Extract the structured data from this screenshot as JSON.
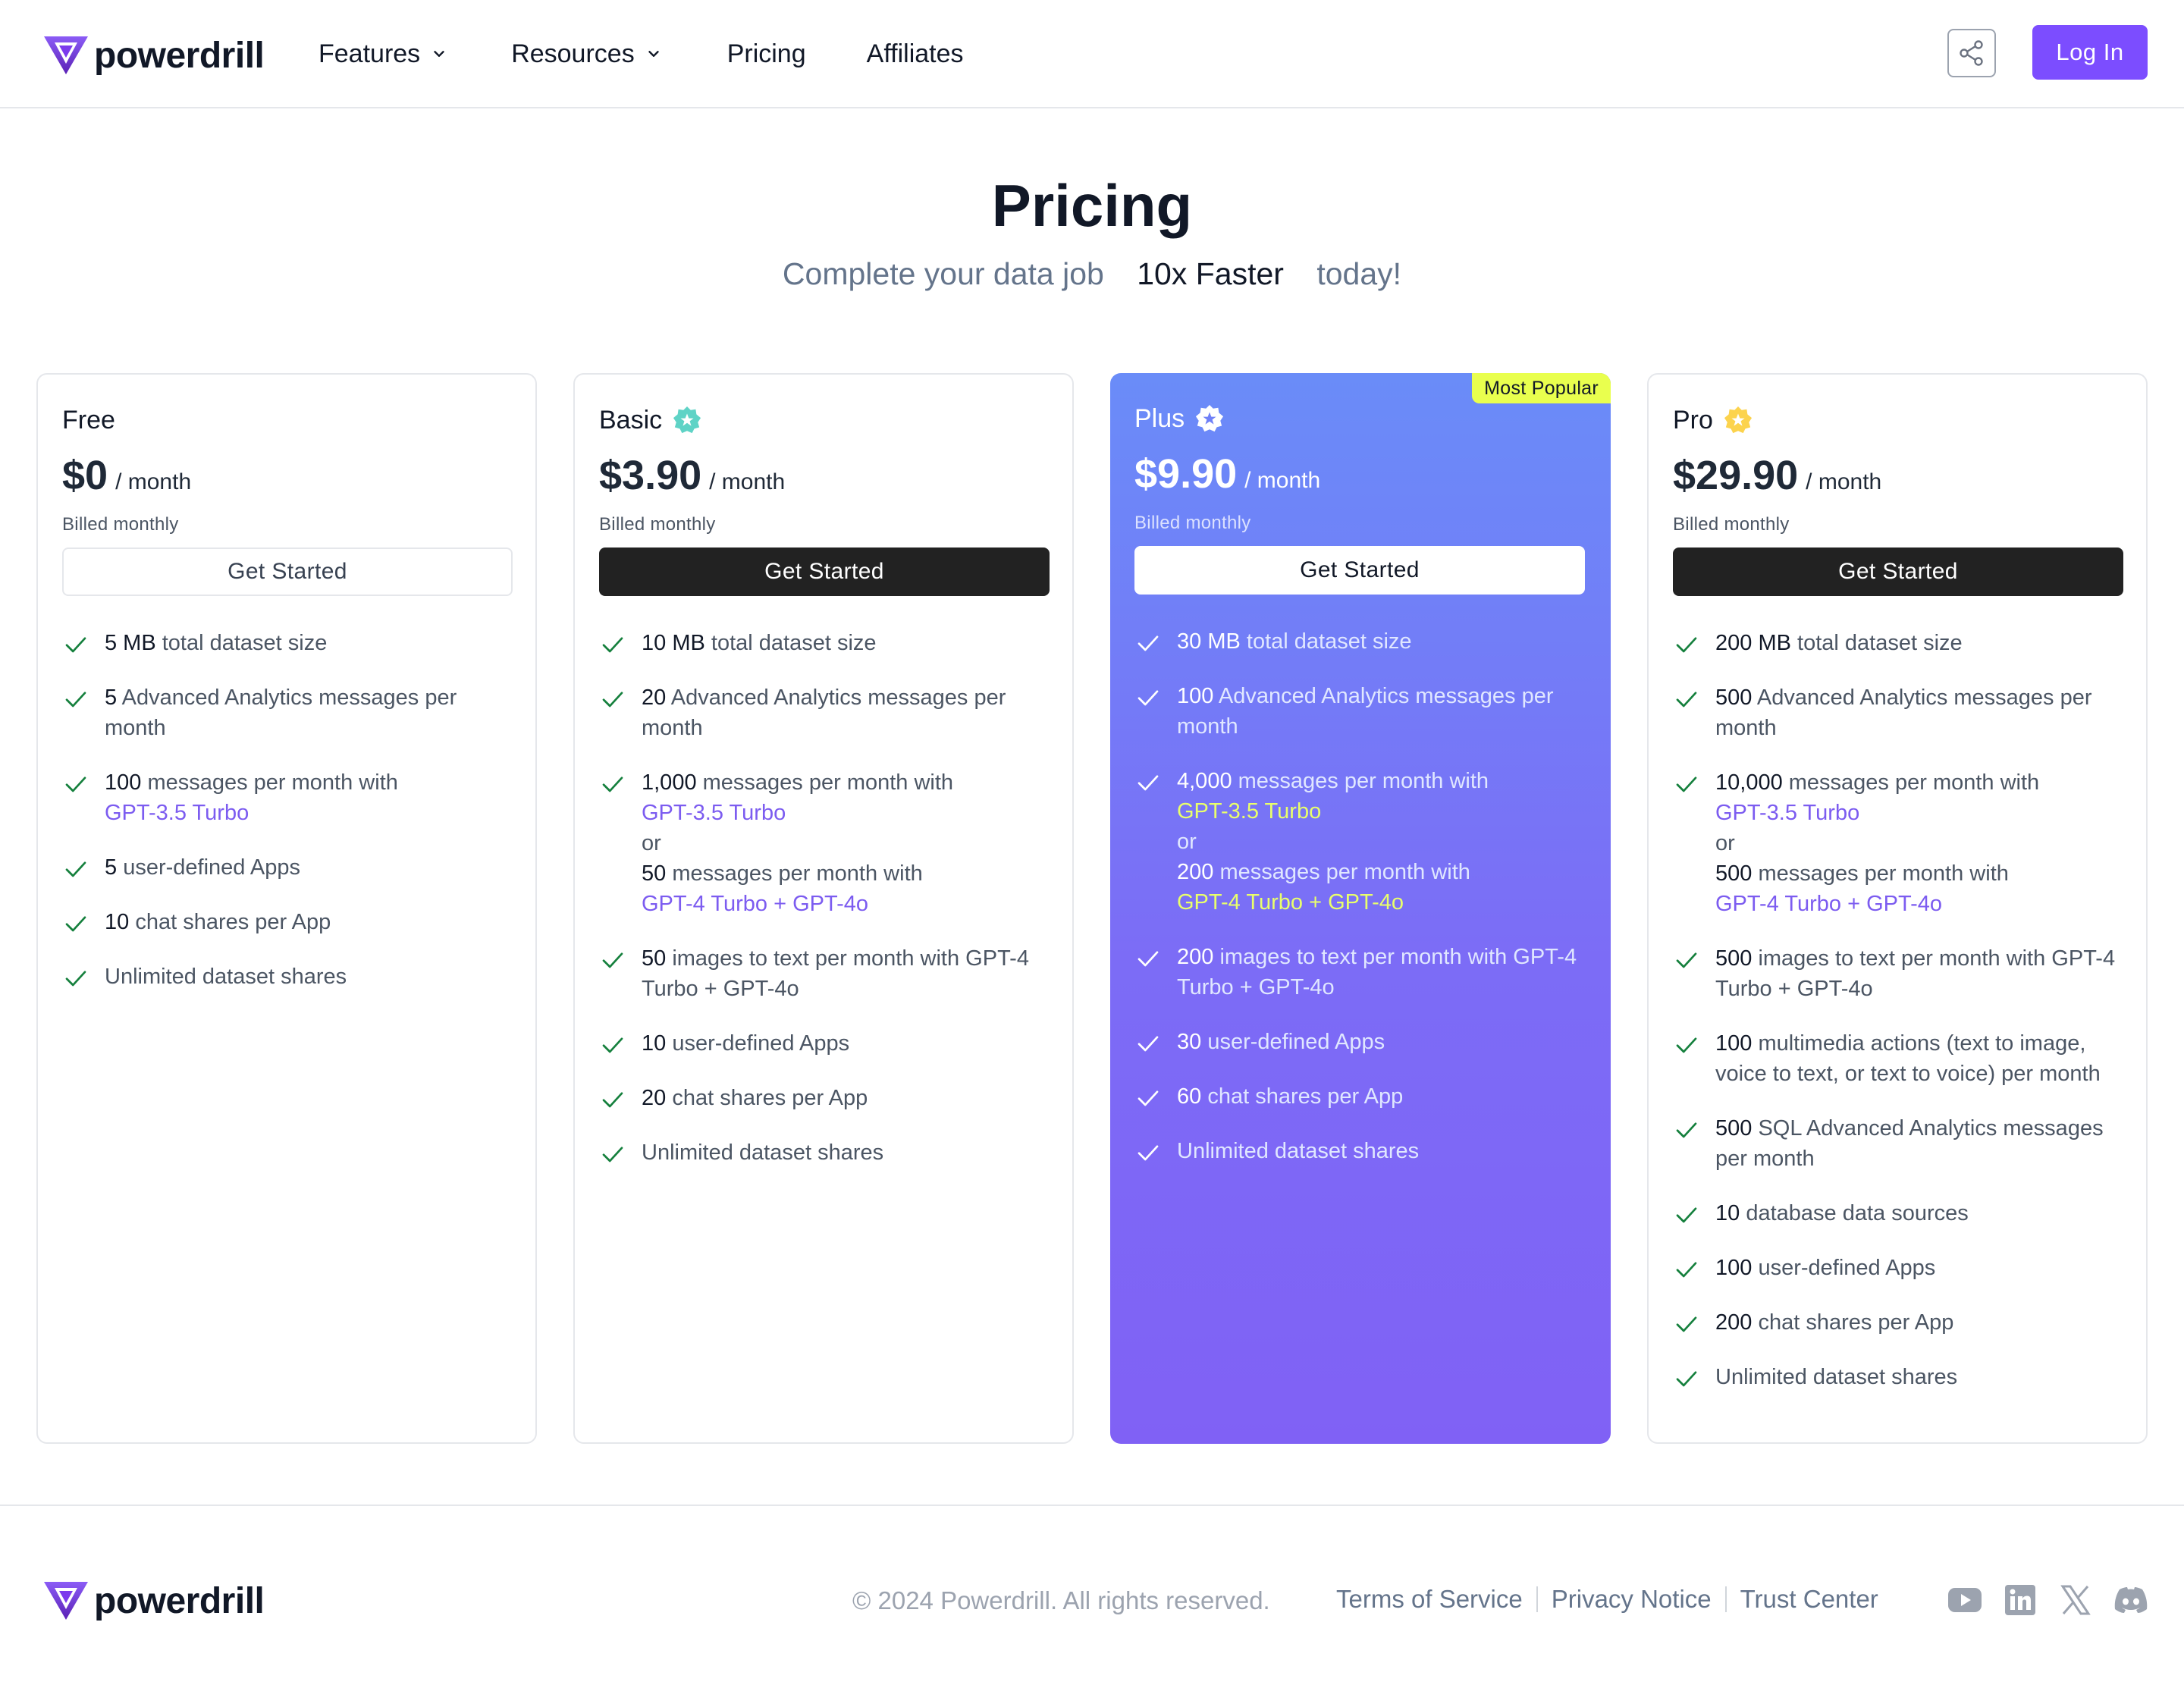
{
  "brand": {
    "name": "powerdrill"
  },
  "nav": {
    "features": "Features",
    "resources": "Resources",
    "pricing": "Pricing",
    "affiliates": "Affiliates"
  },
  "header": {
    "login": "Log In"
  },
  "hero": {
    "title": "Pricing",
    "subtitle_pre": "Complete your data job",
    "subtitle_highlight": "10x Faster",
    "subtitle_post": "today!"
  },
  "colors": {
    "accent": "#7c4dff",
    "highlight": "#fef08a",
    "popular_badge": "#e9ff4e",
    "check": "#15803d"
  },
  "plans": [
    {
      "name": "Free",
      "price": "$0",
      "per": "/ month",
      "billed": "Billed monthly",
      "cta": "Get Started",
      "features": [
        {
          "num": "5 MB",
          "text": " total dataset size"
        },
        {
          "num": "5",
          "text": " Advanced Analytics messages per month"
        },
        {
          "num": "100",
          "text": " messages per month with",
          "link": "GPT-3.5 Turbo"
        },
        {
          "num": "5",
          "text": " user-defined Apps"
        },
        {
          "num": "10",
          "text": " chat shares per App"
        },
        {
          "text": "Unlimited dataset shares"
        }
      ]
    },
    {
      "name": "Basic",
      "price": "$3.90",
      "per": "/ month",
      "billed": "Billed monthly",
      "cta": "Get Started",
      "features": [
        {
          "num": "10 MB",
          "text": " total dataset size"
        },
        {
          "num": "20",
          "text": " Advanced Analytics messages per month"
        },
        {
          "num": "1,000",
          "text": " messages per month with",
          "link": "GPT-3.5 Turbo",
          "or": "or",
          "num2": "50",
          "text2": " messages per month with",
          "link2": "GPT-4 Turbo + GPT-4o"
        },
        {
          "num": "50",
          "text": " images to text per month with GPT-4 Turbo + GPT-4o"
        },
        {
          "num": "10",
          "text": " user-defined Apps"
        },
        {
          "num": "20",
          "text": " chat shares per App"
        },
        {
          "text": "Unlimited dataset shares"
        }
      ]
    },
    {
      "name": "Plus",
      "price": "$9.90",
      "per": "/ month",
      "billed": "Billed monthly",
      "cta": "Get Started",
      "badge": "Most Popular",
      "features": [
        {
          "num": "30 MB",
          "text": " total dataset size"
        },
        {
          "num": "100",
          "text": " Advanced Analytics messages per month"
        },
        {
          "num": "4,000",
          "text": " messages per month with",
          "link": "GPT-3.5 Turbo",
          "or": "or",
          "num2": "200",
          "text2": " messages per month with",
          "link2": "GPT-4 Turbo + GPT-4o"
        },
        {
          "num": "200",
          "text": " images to text per month with GPT-4 Turbo + GPT-4o"
        },
        {
          "num": "30",
          "text": " user-defined Apps"
        },
        {
          "num": "60",
          "text": " chat shares per App"
        },
        {
          "text": "Unlimited dataset shares"
        }
      ]
    },
    {
      "name": "Pro",
      "price": "$29.90",
      "per": "/ month",
      "billed": "Billed monthly",
      "cta": "Get Started",
      "features": [
        {
          "num": "200 MB",
          "text": " total dataset size"
        },
        {
          "num": "500",
          "text": " Advanced Analytics messages per month"
        },
        {
          "num": "10,000",
          "text": " messages per month with",
          "link": "GPT-3.5 Turbo",
          "or": "or",
          "num2": "500",
          "text2": " messages per month with",
          "link2": "GPT-4 Turbo + GPT-4o"
        },
        {
          "num": "500",
          "text": " images to text per month with GPT-4 Turbo + GPT-4o"
        },
        {
          "num": "100",
          "text": " multimedia actions (text to image, voice to text, or text to voice) per month"
        },
        {
          "num": "500",
          "text": " SQL Advanced Analytics messages per month"
        },
        {
          "num": "10",
          "text": " database data sources"
        },
        {
          "num": "100",
          "text": " user-defined Apps"
        },
        {
          "num": "200",
          "text": " chat shares per App"
        },
        {
          "text": "Unlimited dataset shares"
        }
      ]
    }
  ],
  "footer": {
    "copyright": "© 2024 Powerdrill. All rights reserved.",
    "terms": "Terms of Service",
    "privacy": "Privacy Notice",
    "trust": "Trust Center",
    "socials": [
      "youtube-icon",
      "linkedin-icon",
      "x-icon",
      "discord-icon"
    ]
  }
}
